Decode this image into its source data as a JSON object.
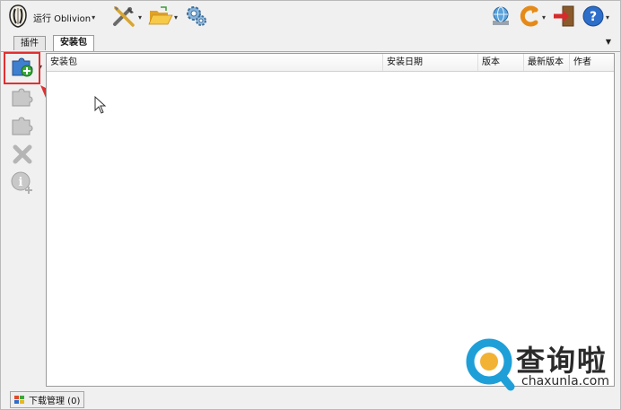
{
  "toolbar": {
    "run_label": "运行 Oblivion",
    "icons": [
      "oblivion-logo-icon",
      "tools-icon",
      "open-folder-icon",
      "settings-gears-icon",
      "network-globe-icon",
      "refresh-icon",
      "exit-icon",
      "help-icon"
    ]
  },
  "tabs": [
    {
      "label": "插件",
      "active": false
    },
    {
      "label": "安装包",
      "active": true
    }
  ],
  "sidebar": {
    "buttons": [
      "add-package-icon",
      "package-icon",
      "package-remove-icon",
      "delete-icon",
      "info-icon"
    ],
    "highlight_color": "#e03030"
  },
  "table": {
    "columns": [
      "安装包",
      "安装日期",
      "版本",
      "最新版本",
      "作者"
    ],
    "rows": []
  },
  "statusbar": {
    "download_label": "下载管理 (0)"
  },
  "watermark": {
    "brand": "查询啦",
    "url": "chaxunla.com",
    "color": "#1e9fd8"
  }
}
